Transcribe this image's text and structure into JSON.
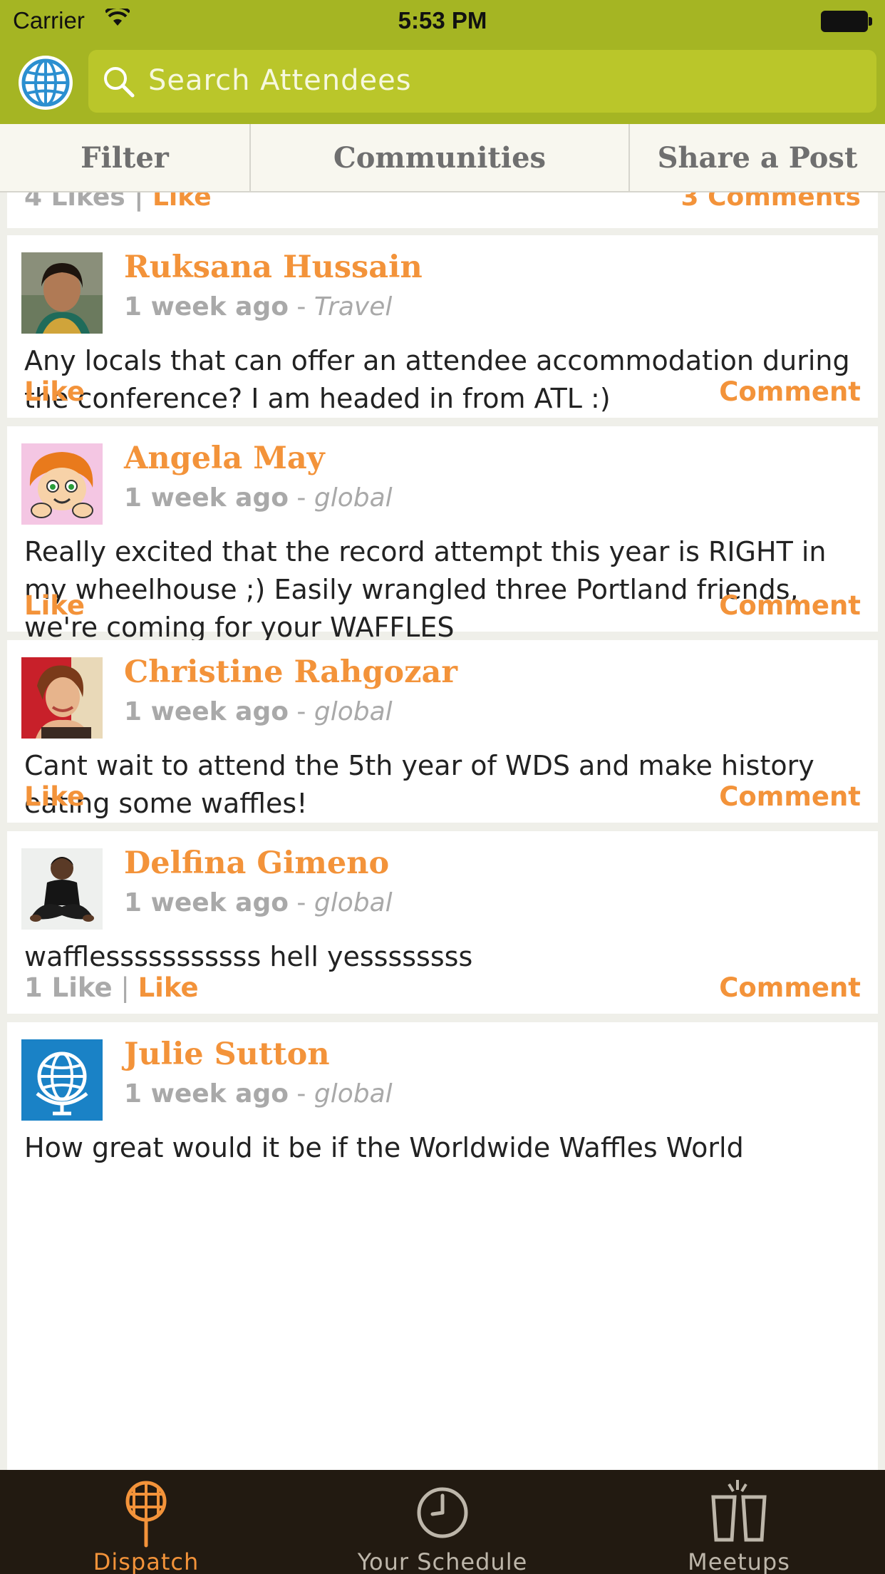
{
  "status_bar": {
    "carrier": "Carrier",
    "time": "5:53 PM"
  },
  "search": {
    "placeholder": "Search Attendees"
  },
  "tabs": [
    {
      "label": "Filter"
    },
    {
      "label": "Communities"
    },
    {
      "label": "Share a Post"
    }
  ],
  "partial_post": {
    "likes": "4 Likes",
    "separator": "|",
    "like": "Like",
    "comments": "3 Comments"
  },
  "posts": [
    {
      "author": "Ruksana Hussain",
      "ago": "1 week ago",
      "dash": " - ",
      "community": "Travel",
      "text": "Any locals that can offer an attendee accommodation during the conference? I am headed in from ATL :)",
      "like": "Like",
      "comment": "Comment"
    },
    {
      "author": "Angela May",
      "ago": "1 week ago",
      "dash": " - ",
      "community": "global",
      "text": "Really excited that the record attempt this year is RIGHT in my wheelhouse ;) Easily wrangled three Portland friends, we're coming for your WAFFLES",
      "like": "Like",
      "comment": "Comment"
    },
    {
      "author": "Christine Rahgozar",
      "ago": "1 week ago",
      "dash": " - ",
      "community": "global",
      "text": "Cant wait to attend the 5th year of WDS and make history eating some waffles!",
      "like": "Like",
      "comment": "Comment"
    },
    {
      "author": "Delfina Gimeno",
      "ago": "1 week ago",
      "dash": " - ",
      "community": "global",
      "text": "wafflesssssssssss hell yessssssss",
      "like_count": "1 Like",
      "separator": " | ",
      "like": "Like",
      "comment": "Comment"
    },
    {
      "author": "Julie Sutton",
      "ago": "1 week ago",
      "dash": " - ",
      "community": "global",
      "text": "How great would it be if the Worldwide Waffles World"
    }
  ],
  "tabbar": [
    {
      "label": "Dispatch",
      "icon": "waffle-racket-icon",
      "active": true
    },
    {
      "label": "Your Schedule",
      "icon": "clock-icon",
      "active": false
    },
    {
      "label": "Meetups",
      "icon": "cups-icon",
      "active": false
    }
  ],
  "colors": {
    "header_green": "#a5b523",
    "accent_orange": "#f3933a",
    "tabbar_bg": "#221a11"
  }
}
